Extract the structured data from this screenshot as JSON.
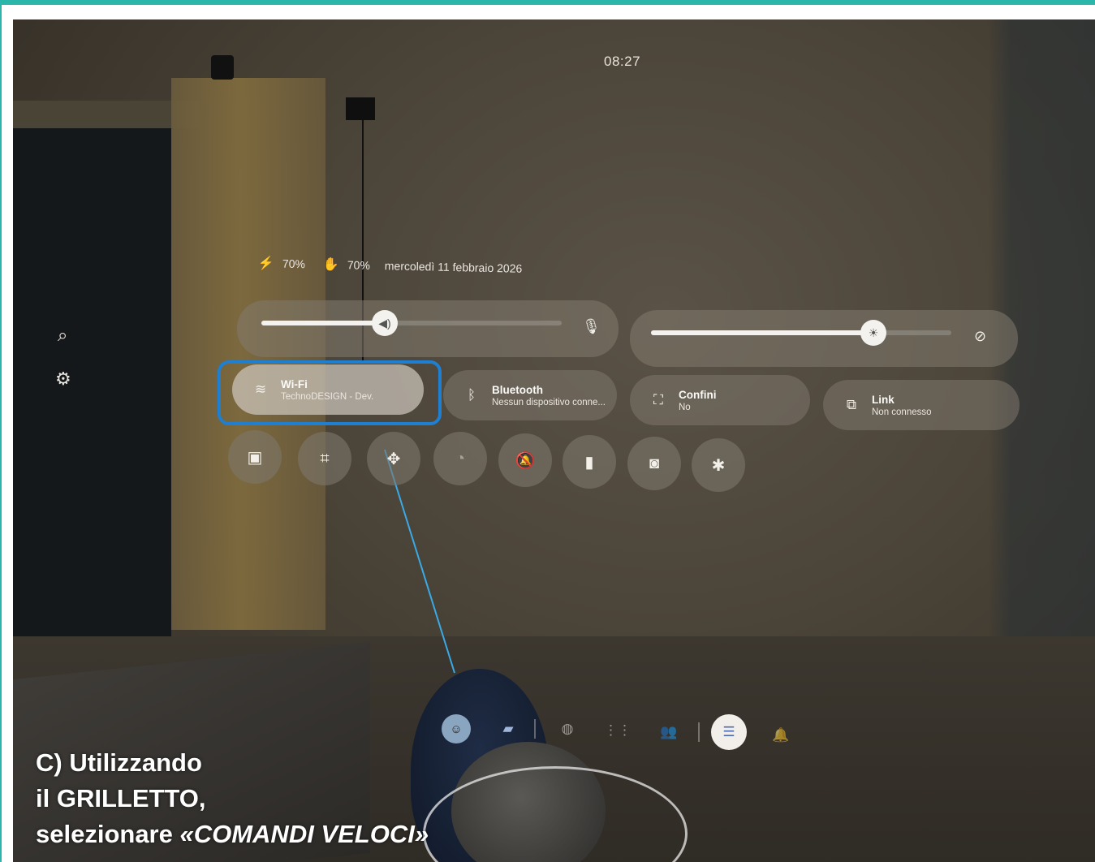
{
  "clock": "08:27",
  "status": {
    "headset_battery": "70%",
    "controller_battery": "70%",
    "date": "mercoledì 11 febbraio 2026"
  },
  "volume_slider": {
    "level": 0.4
  },
  "brightness_slider": {
    "level": 0.7
  },
  "tiles": {
    "wifi": {
      "name": "Wi-Fi",
      "sub": "TechnoDESIGN - Dev."
    },
    "bluetooth": {
      "name": "Bluetooth",
      "sub": "Nessun dispositivo conne..."
    },
    "boundary": {
      "name": "Confini",
      "sub": "No"
    },
    "link": {
      "name": "Link",
      "sub": "Non connesso"
    }
  },
  "quick_buttons": [
    {
      "icon": "cast-icon"
    },
    {
      "icon": "passthrough-icon"
    },
    {
      "icon": "move-icon"
    },
    {
      "icon": "audio-share-icon"
    },
    {
      "icon": "notifications-off-icon"
    },
    {
      "icon": "battery-saver-icon"
    },
    {
      "icon": "camera-icon"
    },
    {
      "icon": "bug-report-icon"
    }
  ],
  "caption": {
    "line1": "C) Utilizzando",
    "line2": "il GRILLETTO,",
    "line3_prefix": "selezionare ",
    "line3_emph": "«COMANDI VELOCI»"
  },
  "colors": {
    "highlight": "#1f7fd1",
    "frame_accent": "#2ab7a9"
  }
}
